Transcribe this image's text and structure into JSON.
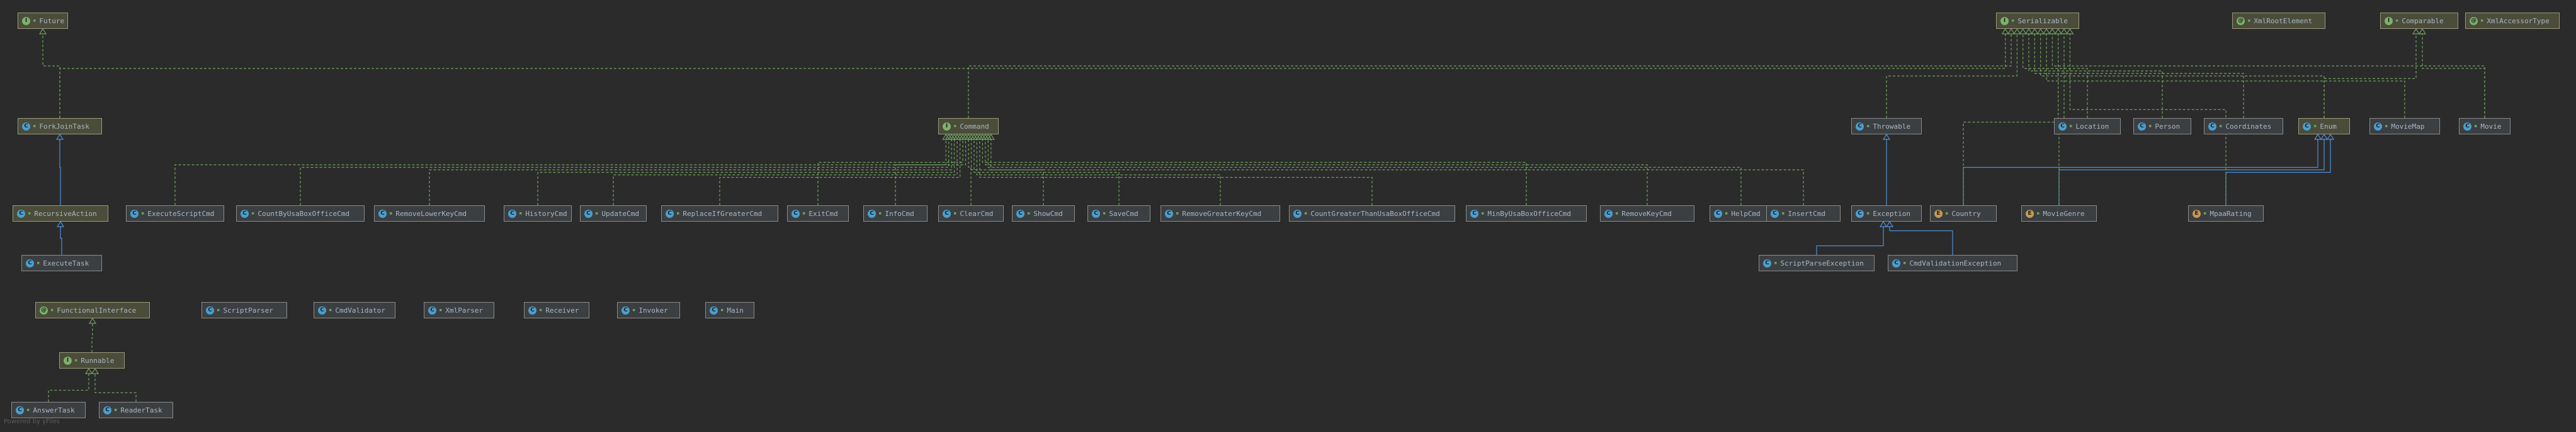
{
  "colors": {
    "background": "#2b2b2b",
    "implements_edge": "#6fa05c",
    "extends_edge": "#4f8fd6",
    "node_border": "#8a8a8a"
  },
  "nodes": [
    {
      "id": "future",
      "label": "Future",
      "kind": "interface"
    },
    {
      "id": "forkjointask",
      "label": "ForkJoinTask",
      "kind": "abstract"
    },
    {
      "id": "recursiveaction",
      "label": "RecursiveAction",
      "kind": "abstract"
    },
    {
      "id": "executetask",
      "label": "ExecuteTask",
      "kind": "class"
    },
    {
      "id": "functionalinterface",
      "label": "FunctionalInterface",
      "kind": "annotation"
    },
    {
      "id": "runnable",
      "label": "Runnable",
      "kind": "interface"
    },
    {
      "id": "answertask",
      "label": "AnswerTask",
      "kind": "class"
    },
    {
      "id": "readertask",
      "label": "ReaderTask",
      "kind": "class"
    },
    {
      "id": "scriptparser",
      "label": "ScriptParser",
      "kind": "class"
    },
    {
      "id": "cmdvalidator",
      "label": "CmdValidator",
      "kind": "class"
    },
    {
      "id": "xmlparser",
      "label": "XmlParser",
      "kind": "class"
    },
    {
      "id": "receiver",
      "label": "Receiver",
      "kind": "class"
    },
    {
      "id": "invoker",
      "label": "Invoker",
      "kind": "class"
    },
    {
      "id": "main",
      "label": "Main",
      "kind": "class"
    },
    {
      "id": "command",
      "label": "Command",
      "kind": "interface"
    },
    {
      "id": "executescriptcmd",
      "label": "ExecuteScriptCmd",
      "kind": "class"
    },
    {
      "id": "countbyusaboxofficecmd",
      "label": "CountByUsaBoxOfficeCmd",
      "kind": "class"
    },
    {
      "id": "removelowerkeycmd",
      "label": "RemoveLowerKeyCmd",
      "kind": "class"
    },
    {
      "id": "historycmd",
      "label": "HistoryCmd",
      "kind": "class"
    },
    {
      "id": "updatecmd",
      "label": "UpdateCmd",
      "kind": "class"
    },
    {
      "id": "replaceifgreatercmd",
      "label": "ReplaceIfGreaterCmd",
      "kind": "class"
    },
    {
      "id": "exitcmd",
      "label": "ExitCmd",
      "kind": "class"
    },
    {
      "id": "infocmd",
      "label": "InfoCmd",
      "kind": "class"
    },
    {
      "id": "clearcmd",
      "label": "ClearCmd",
      "kind": "class"
    },
    {
      "id": "showcmd",
      "label": "ShowCmd",
      "kind": "class"
    },
    {
      "id": "savecmd",
      "label": "SaveCmd",
      "kind": "class"
    },
    {
      "id": "removegreaterkeycmd",
      "label": "RemoveGreaterKeyCmd",
      "kind": "class"
    },
    {
      "id": "countgreaterthanusaboxofficecmd",
      "label": "CountGreaterThanUsaBoxOfficeCmd",
      "kind": "class"
    },
    {
      "id": "minbyusaboxofficecmd",
      "label": "MinByUsaBoxOfficeCmd",
      "kind": "class"
    },
    {
      "id": "removekeycmd",
      "label": "RemoveKeyCmd",
      "kind": "class"
    },
    {
      "id": "helpcmd",
      "label": "HelpCmd",
      "kind": "class"
    },
    {
      "id": "insertcmd",
      "label": "InsertCmd",
      "kind": "class"
    },
    {
      "id": "throwable",
      "label": "Throwable",
      "kind": "class"
    },
    {
      "id": "exception",
      "label": "Exception",
      "kind": "class"
    },
    {
      "id": "scriptparseexception",
      "label": "ScriptParseException",
      "kind": "class"
    },
    {
      "id": "cmdvalidationexception",
      "label": "CmdValidationException",
      "kind": "class"
    },
    {
      "id": "serializable",
      "label": "Serializable",
      "kind": "interface"
    },
    {
      "id": "xmlrootelement",
      "label": "XmlRootElement",
      "kind": "annotation"
    },
    {
      "id": "comparable",
      "label": "Comparable",
      "kind": "interface"
    },
    {
      "id": "xmlaccessortype",
      "label": "XmlAccessorType",
      "kind": "annotation"
    },
    {
      "id": "location",
      "label": "Location",
      "kind": "class"
    },
    {
      "id": "person",
      "label": "Person",
      "kind": "class"
    },
    {
      "id": "coordinates",
      "label": "Coordinates",
      "kind": "class"
    },
    {
      "id": "enum",
      "label": "Enum",
      "kind": "abstract"
    },
    {
      "id": "moviemap",
      "label": "MovieMap",
      "kind": "class"
    },
    {
      "id": "movie",
      "label": "Movie",
      "kind": "class"
    },
    {
      "id": "country",
      "label": "Country",
      "kind": "enum"
    },
    {
      "id": "moviegenre",
      "label": "MovieGenre",
      "kind": "enum"
    },
    {
      "id": "mpaarating",
      "label": "MpaaRating",
      "kind": "enum"
    }
  ],
  "edges": [
    {
      "from": "forkjointask",
      "to": "future",
      "type": "implements"
    },
    {
      "from": "forkjointask",
      "to": "serializable",
      "type": "implements"
    },
    {
      "from": "recursiveaction",
      "to": "forkjointask",
      "type": "extends"
    },
    {
      "from": "executetask",
      "to": "recursiveaction",
      "type": "extends"
    },
    {
      "from": "runnable",
      "to": "functionalinterface",
      "type": "implements"
    },
    {
      "from": "answertask",
      "to": "runnable",
      "type": "implements"
    },
    {
      "from": "readertask",
      "to": "runnable",
      "type": "implements"
    },
    {
      "from": "command",
      "to": "serializable",
      "type": "implements"
    },
    {
      "from": "executescriptcmd",
      "to": "command",
      "type": "implements"
    },
    {
      "from": "countbyusaboxofficecmd",
      "to": "command",
      "type": "implements"
    },
    {
      "from": "removelowerkeycmd",
      "to": "command",
      "type": "implements"
    },
    {
      "from": "historycmd",
      "to": "command",
      "type": "implements"
    },
    {
      "from": "updatecmd",
      "to": "command",
      "type": "implements"
    },
    {
      "from": "replaceifgreatercmd",
      "to": "command",
      "type": "implements"
    },
    {
      "from": "exitcmd",
      "to": "command",
      "type": "implements"
    },
    {
      "from": "infocmd",
      "to": "command",
      "type": "implements"
    },
    {
      "from": "clearcmd",
      "to": "command",
      "type": "implements"
    },
    {
      "from": "showcmd",
      "to": "command",
      "type": "implements"
    },
    {
      "from": "savecmd",
      "to": "command",
      "type": "implements"
    },
    {
      "from": "removegreaterkeycmd",
      "to": "command",
      "type": "implements"
    },
    {
      "from": "countgreaterthanusaboxofficecmd",
      "to": "command",
      "type": "implements"
    },
    {
      "from": "minbyusaboxofficecmd",
      "to": "command",
      "type": "implements"
    },
    {
      "from": "removekeycmd",
      "to": "command",
      "type": "implements"
    },
    {
      "from": "helpcmd",
      "to": "command",
      "type": "implements"
    },
    {
      "from": "insertcmd",
      "to": "command",
      "type": "implements"
    },
    {
      "from": "throwable",
      "to": "serializable",
      "type": "implements"
    },
    {
      "from": "exception",
      "to": "throwable",
      "type": "extends"
    },
    {
      "from": "scriptparseexception",
      "to": "exception",
      "type": "extends"
    },
    {
      "from": "cmdvalidationexception",
      "to": "exception",
      "type": "extends"
    },
    {
      "from": "location",
      "to": "serializable",
      "type": "implements"
    },
    {
      "from": "person",
      "to": "serializable",
      "type": "implements"
    },
    {
      "from": "coordinates",
      "to": "serializable",
      "type": "implements"
    },
    {
      "from": "enum",
      "to": "serializable",
      "type": "implements"
    },
    {
      "from": "enum",
      "to": "comparable",
      "type": "implements"
    },
    {
      "from": "moviemap",
      "to": "serializable",
      "type": "implements"
    },
    {
      "from": "movie",
      "to": "serializable",
      "type": "implements"
    },
    {
      "from": "movie",
      "to": "comparable",
      "type": "implements"
    },
    {
      "from": "country",
      "to": "enum",
      "type": "extends"
    },
    {
      "from": "moviegenre",
      "to": "enum",
      "type": "extends"
    },
    {
      "from": "mpaarating",
      "to": "enum",
      "type": "extends"
    },
    {
      "from": "country",
      "to": "serializable",
      "type": "implements"
    },
    {
      "from": "moviegenre",
      "to": "serializable",
      "type": "implements"
    },
    {
      "from": "mpaarating",
      "to": "serializable",
      "type": "implements"
    }
  ],
  "watermark": "Powered by yFiles"
}
